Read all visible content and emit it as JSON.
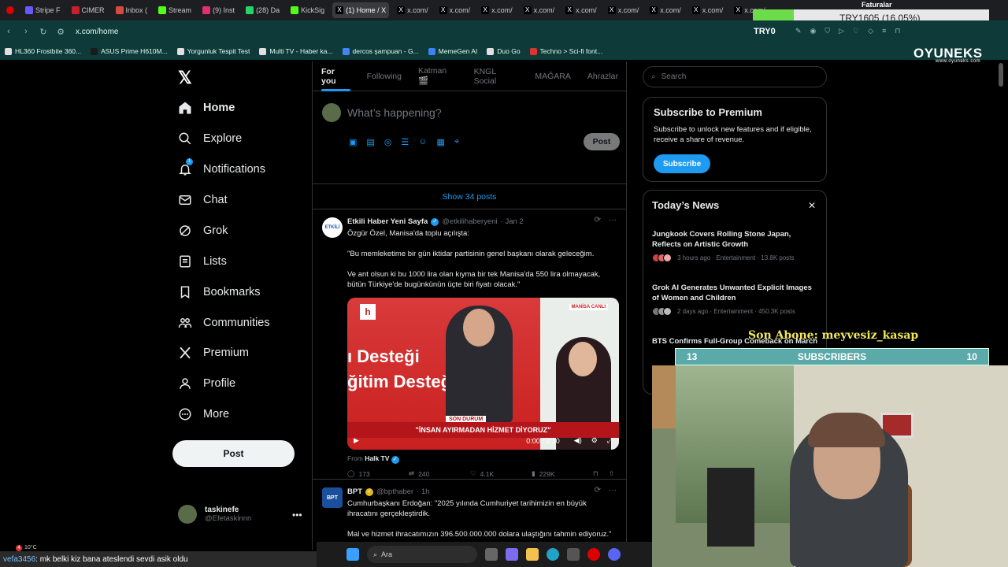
{
  "browser": {
    "tabs": [
      {
        "label": "Stripe F",
        "color": "#635bff"
      },
      {
        "label": "CIMER",
        "color": "#c8202a"
      },
      {
        "label": "Inbox (",
        "color": "#d54b3d"
      },
      {
        "label": "Stream",
        "color": "#53fc18"
      },
      {
        "label": "(9) Inst",
        "color": "#e1306c"
      },
      {
        "label": "(28) Da",
        "color": "#25d366"
      },
      {
        "label": "KickSig",
        "color": "#53fc18"
      },
      {
        "label": "(1) Home / X",
        "color": "#000000",
        "active": true
      },
      {
        "label": "x.com/",
        "color": "#000000"
      },
      {
        "label": "x.com/",
        "color": "#000000"
      },
      {
        "label": "x.com/",
        "color": "#000000"
      },
      {
        "label": "x.com/",
        "color": "#000000"
      },
      {
        "label": "x.com/",
        "color": "#000000"
      },
      {
        "label": "x.com/",
        "color": "#000000"
      },
      {
        "label": "x.com/",
        "color": "#000000"
      },
      {
        "label": "x.com/",
        "color": "#000000"
      },
      {
        "label": "x.com/",
        "color": "#000000"
      }
    ],
    "url": "x.com/home",
    "bookmarks": [
      {
        "label": "HL360 Frostbite 360...",
        "color": "#e0e0e0"
      },
      {
        "label": "ASUS Prime H610M...",
        "color": "#1a1a1a"
      },
      {
        "label": "Yorgunluk Tespit Test",
        "color": "#e0e0e0"
      },
      {
        "label": "Multi TV - Haber ka...",
        "color": "#e0e0e0"
      },
      {
        "label": "dercos şampuan - G...",
        "color": "#4285f4"
      },
      {
        "label": "MemeGen AI",
        "color": "#3b82f6"
      },
      {
        "label": "Duo Go",
        "color": "#e0e0e0"
      },
      {
        "label": "Techno > Sci-fi font...",
        "color": "#d33"
      }
    ]
  },
  "overlays": {
    "faturalar": "Faturalar",
    "price": "TRY1605 (16.05%)",
    "try_label": "TRY0",
    "oyuneks": "OYUNEKS",
    "oyuneks_url": "www.oyuneks.com",
    "son_abone": "Son Abone: meyvesiz_kasap",
    "subs_left": "13",
    "subs_label": "SUBSCRIBERS",
    "subs_right": "10",
    "chat_user": "vefa3456",
    "chat_msg": ": mk belki kiz bana ateslendi sevdi asik oldu",
    "weather": "10°C",
    "weather_badge": "4",
    "taskbar_search": "Ara"
  },
  "nav": {
    "items": [
      {
        "label": "Home",
        "icon": "home-icon"
      },
      {
        "label": "Explore",
        "icon": "search-icon"
      },
      {
        "label": "Notifications",
        "icon": "bell-icon"
      },
      {
        "label": "Chat",
        "icon": "mail-icon"
      },
      {
        "label": "Grok",
        "icon": "grok-icon"
      },
      {
        "label": "Lists",
        "icon": "list-icon"
      },
      {
        "label": "Bookmarks",
        "icon": "bookmark-icon"
      },
      {
        "label": "Communities",
        "icon": "communities-icon"
      },
      {
        "label": "Premium",
        "icon": "x-icon"
      },
      {
        "label": "Profile",
        "icon": "person-icon"
      },
      {
        "label": "More",
        "icon": "more-icon"
      }
    ],
    "notification_badge": "1",
    "post_label": "Post",
    "account": {
      "name": "taskinefe",
      "handle": "@Efetaskinnn"
    }
  },
  "timeline": {
    "tabs": [
      "For you",
      "Following",
      "Katman 🎬",
      "KNGL Social",
      "MAĞARA",
      "Ahrazlar"
    ],
    "composer_placeholder": "What’s happening?",
    "composer_post": "Post",
    "show_posts": "Show 34 posts",
    "tweets": [
      {
        "name": "Etkili Haber Yeni Sayfa",
        "handle": "@etkilihaberyeni",
        "time": "· Jan 2",
        "lines": [
          "Özgür Özel, Manisa'da toplu açılışta:",
          "\"Bu memleketime bir gün iktidar partisinin genel başkanı olarak geleceğim.",
          "Ve ant olsun ki bu 1000 lira olan kıyma bir tek Manisa'da 550 lira olmayacak, bütün Türkiye'de bugünkünün üçte biri fiyatı olacak.\""
        ],
        "video": {
          "headline1": "ı Desteği",
          "headline2": "ğitim Desteğ",
          "ticker": "\"İNSAN AYIRMADAN HİZMET DİYORUZ\"",
          "ticker_label": "SON DURUM",
          "canli": "MANİSA CANLI",
          "time": "0:00 / 2:10"
        },
        "from_label": "From",
        "from_source": "Halk TV",
        "stats": {
          "replies": "173",
          "reposts": "240",
          "likes": "4.1K",
          "views": "229K"
        }
      },
      {
        "name": "BPT",
        "handle": "@bpthaber",
        "time": "· 1h",
        "lines": [
          "Cumhurbaşkanı Erdoğan: \"2025 yılında Cumhuriyet tarihimizin en büyük ihracatını gerçekleştirdik.",
          "Mal ve hizmet ihracatımızın 396.500.000.000 dolara ulaştığını tahmin ediyoruz.\""
        ]
      }
    ]
  },
  "right": {
    "search_placeholder": "Search",
    "premium_title": "Subscribe to Premium",
    "premium_text": "Subscribe to unlock new features and if eligible, receive a share of revenue.",
    "subscribe_label": "Subscribe",
    "news_title": "Today’s News",
    "news": [
      {
        "title": "Jungkook Covers Rolling Stone Japan, Reflects on Artistic Growth",
        "meta": "3 hours ago · Entertainment · 13.8K posts"
      },
      {
        "title": "Grok AI Generates Unwanted Explicit Images of Women and Children",
        "meta": "2 days ago · Entertainment · 450.3K posts"
      },
      {
        "title": "BTS Confirms Full-Group Comeback on March",
        "meta": ""
      }
    ]
  }
}
